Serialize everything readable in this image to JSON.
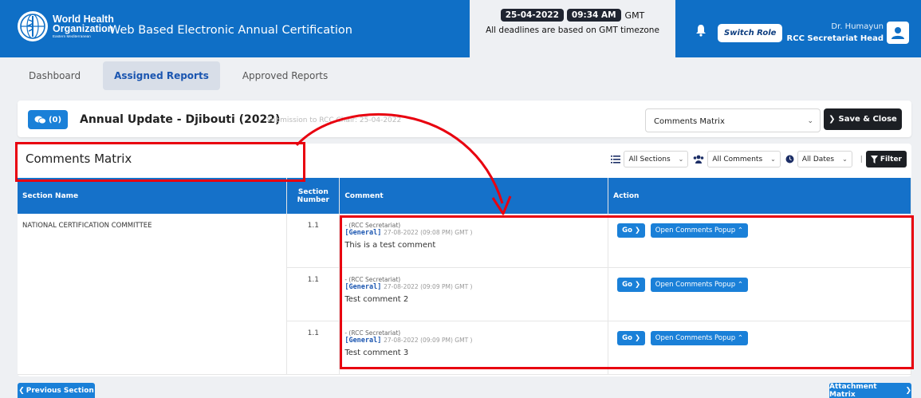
{
  "header": {
    "org_name_line1": "World Health",
    "org_name_line2": "Organization",
    "org_sub": "Eastern Mediterranean",
    "app_title": "Web Based Electronic Annual Certification",
    "date": "25-04-2022",
    "time": "09:34 AM",
    "timezone": "GMT",
    "deadline_note": "All deadlines are based on GMT timezone",
    "switch_role_label": "Switch Role",
    "user_name": "Dr. Humayun",
    "user_role": "RCC Secretariat Head"
  },
  "tabs": [
    {
      "label": "Dashboard",
      "active": false
    },
    {
      "label": "Assigned Reports",
      "active": true
    },
    {
      "label": "Approved Reports",
      "active": false
    }
  ],
  "report": {
    "comment_count": "(0)",
    "title": "Annual Update - Djibouti (2022)",
    "submission": "Submission to RCC Chair: 25-04-2022",
    "matrix_select": "Comments Matrix",
    "save_close_label": "Save & Close"
  },
  "panel": {
    "title": "Comments Matrix",
    "filters": {
      "sections": "All Sections",
      "comments": "All Comments",
      "dates": "All Dates",
      "filter_label": "Filter"
    },
    "columns": [
      "Section Name",
      "Section Number",
      "Comment",
      "Action"
    ],
    "section_name": "NATIONAL CERTIFICATION COMMITTEE",
    "rows": [
      {
        "number": "1.1",
        "author": "- (RCC Secretariat)",
        "tag": "[General]",
        "date": "27-08-2022 (09:08 PM) GMT )",
        "text": "This is a test comment"
      },
      {
        "number": "1.1",
        "author": "- (RCC Secretariat)",
        "tag": "[General]",
        "date": "27-08-2022 (09:09 PM) GMT )",
        "text": "Test comment 2"
      },
      {
        "number": "1.1",
        "author": "- (RCC Secretariat)",
        "tag": "[General]",
        "date": "27-08-2022 (09:09 PM) GMT )",
        "text": "Test comment 3"
      }
    ],
    "go_label": "Go",
    "popup_label": "Open Comments Popup"
  },
  "footer": {
    "prev_label": "Previous Section",
    "attach_label": "Attachment Matrix"
  },
  "colors": {
    "brand_blue": "#0f6fc6",
    "table_header": "#1571c9",
    "button_blue": "#1a80d8",
    "annotation_red": "#e8000f"
  }
}
